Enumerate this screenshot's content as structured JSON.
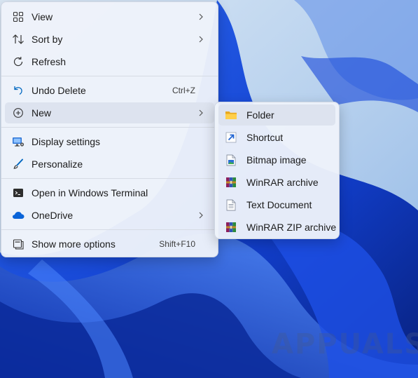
{
  "context_menu": {
    "items": [
      {
        "label": "View",
        "icon": "view-grid-icon",
        "shortcut": "",
        "has_submenu": true
      },
      {
        "label": "Sort by",
        "icon": "sort-icon",
        "shortcut": "",
        "has_submenu": true
      },
      {
        "label": "Refresh",
        "icon": "refresh-icon",
        "shortcut": "",
        "has_submenu": false
      },
      {
        "label": "Undo Delete",
        "icon": "undo-icon",
        "shortcut": "Ctrl+Z",
        "has_submenu": false
      },
      {
        "label": "New",
        "icon": "new-plus-icon",
        "shortcut": "",
        "has_submenu": true,
        "highlighted": true
      },
      {
        "label": "Display settings",
        "icon": "display-settings-icon",
        "shortcut": "",
        "has_submenu": false
      },
      {
        "label": "Personalize",
        "icon": "personalize-brush-icon",
        "shortcut": "",
        "has_submenu": false
      },
      {
        "label": "Open in Windows Terminal",
        "icon": "terminal-icon",
        "shortcut": "",
        "has_submenu": false
      },
      {
        "label": "OneDrive",
        "icon": "onedrive-cloud-icon",
        "shortcut": "",
        "has_submenu": true
      },
      {
        "label": "Show more options",
        "icon": "show-more-options-icon",
        "shortcut": "Shift+F10",
        "has_submenu": false
      }
    ]
  },
  "new_submenu": {
    "items": [
      {
        "label": "Folder",
        "icon": "folder-icon",
        "highlighted": true
      },
      {
        "label": "Shortcut",
        "icon": "shortcut-arrow-icon"
      },
      {
        "label": "Bitmap image",
        "icon": "bitmap-image-icon"
      },
      {
        "label": "WinRAR archive",
        "icon": "winrar-archive-icon"
      },
      {
        "label": "Text Document",
        "icon": "text-document-icon"
      },
      {
        "label": "WinRAR ZIP archive",
        "icon": "winrar-zip-icon"
      }
    ]
  },
  "watermark": "APPUALS",
  "colors": {
    "menu_background": "#eef2fa",
    "highlight": "#dde3ef",
    "wallpaper_dark": "#0a2b9c",
    "wallpaper_light": "#c6dcf0",
    "accent": "#0067c0"
  }
}
